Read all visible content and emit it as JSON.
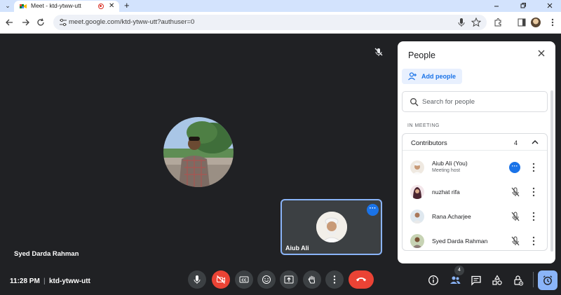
{
  "browser": {
    "tab_title": "Meet - ktd-ytww-utt",
    "tab_close": "✕",
    "new_tab": "+",
    "url": "meet.google.com/ktd-ytww-utt?authuser=0"
  },
  "people_panel": {
    "title": "People",
    "add_people": "Add people",
    "search_placeholder": "Search for people",
    "section": "IN MEETING",
    "group_label": "Contributors",
    "group_count": "4",
    "participants": [
      {
        "name": "Aiub Ali (You)",
        "subtitle": "Meeting host"
      },
      {
        "name": "nuzhat rifa"
      },
      {
        "name": "Rana Acharjee"
      },
      {
        "name": "Syed Darda Rahman"
      }
    ]
  },
  "stage": {
    "main_participant": "Syed Darda Rahman",
    "self_tile_name": "Aiub Ali"
  },
  "bottom_bar": {
    "time": "11:28 PM",
    "separator": "|",
    "meeting_code": "ktd-ytww-utt",
    "people_count": "4"
  },
  "colors": {
    "background": "#202124",
    "accent": "#1a73e8",
    "end_call": "#ea4335",
    "self_border": "#8ab4f8"
  },
  "icons": [
    "mic-icon",
    "camera-off-icon",
    "captions-icon",
    "emoji-icon",
    "present-icon",
    "raise-hand-icon",
    "more-options-icon",
    "end-call-icon",
    "info-icon",
    "people-icon",
    "chat-icon",
    "activities-icon",
    "host-controls-icon",
    "lock-icon"
  ]
}
